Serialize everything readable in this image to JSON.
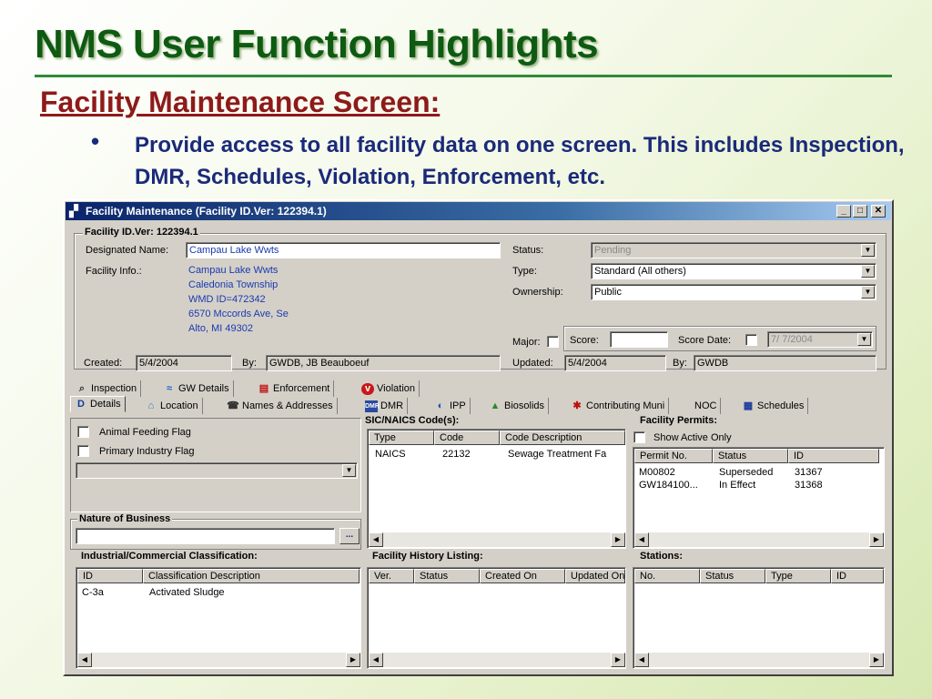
{
  "slide": {
    "title": "NMS User Function Highlights",
    "subtitle": "Facility Maintenance Screen:",
    "bullet_glyph": "•",
    "bullet_text": "Provide access to all facility data on one screen.  This includes Inspection, DMR, Schedules, Violation, Enforcement, etc."
  },
  "window": {
    "title": "Facility Maintenance (Facility ID.Ver: 122394.1)",
    "controls": {
      "minimize": "_",
      "maximize": "□",
      "close": "✕"
    }
  },
  "facility": {
    "group_label": "Facility ID.Ver: 122394.1",
    "designated_name_label": "Designated Name:",
    "designated_name": "Campau Lake Wwts",
    "info_label": "Facility Info.:",
    "info_lines": [
      "Campau Lake Wwts",
      "Caledonia Township",
      "WMD ID=472342",
      "6570 Mccords Ave, Se",
      "Alto, MI 49302"
    ],
    "status_label": "Status:",
    "status": "Pending",
    "type_label": "Type:",
    "type": "Standard (All others)",
    "ownership_label": "Ownership:",
    "ownership": "Public",
    "major_label": "Major:",
    "score_label": "Score:",
    "score": "",
    "score_date_label": "Score Date:",
    "score_date": "7/  7/2004",
    "created_label": "Created:",
    "created": "5/4/2004",
    "created_by_label": "By:",
    "created_by": "GWDB, JB Beauboeuf",
    "updated_label": "Updated:",
    "updated": "5/4/2004",
    "updated_by_label": "By:",
    "updated_by": "GWDB"
  },
  "tabs_row1": [
    {
      "label": "Inspection",
      "icon": "magnifier-icon"
    },
    {
      "label": "GW Details",
      "icon": "water-icon"
    },
    {
      "label": "Enforcement",
      "icon": "enforcement-icon"
    },
    {
      "label": "Violation",
      "icon": "violation-icon"
    }
  ],
  "tabs_row2": [
    {
      "label": "Details",
      "icon": "details-icon"
    },
    {
      "label": "Location",
      "icon": "map-icon"
    },
    {
      "label": "Names & Addresses",
      "icon": "addressbook-icon"
    },
    {
      "label": "DMR",
      "icon": "dmr-icon"
    },
    {
      "label": "IPP",
      "icon": "ipp-icon"
    },
    {
      "label": "Biosolids",
      "icon": "biosolids-icon"
    },
    {
      "label": "Contributing Muni",
      "icon": "muni-icon"
    },
    {
      "label": "NOC",
      "icon": ""
    },
    {
      "label": "Schedules",
      "icon": "calendar-icon"
    }
  ],
  "details": {
    "animal_feeding_label": "Animal Feeding Flag",
    "primary_industry_label": "Primary Industry Flag",
    "nature_label": "Nature of Business",
    "browse_label": "..."
  },
  "sic": {
    "label": "SIC/NAICS Code(s):",
    "headers": [
      "Type",
      "Code",
      "Code Description"
    ],
    "rows": [
      [
        "NAICS",
        "22132",
        "Sewage Treatment Fa"
      ]
    ]
  },
  "permits": {
    "label": "Facility Permits:",
    "show_active_label": "Show Active Only",
    "headers": [
      "Permit No.",
      "Status",
      "ID"
    ],
    "rows": [
      [
        "M00802",
        "Superseded",
        "31367"
      ],
      [
        "GW184100...",
        "In Effect",
        "31368"
      ]
    ]
  },
  "industrial": {
    "label": "Industrial/Commercial Classification:",
    "headers": [
      "ID",
      "Classification Description"
    ],
    "rows": [
      [
        "C-3a",
        "Activated Sludge"
      ]
    ]
  },
  "history": {
    "label": "Facility History Listing:",
    "headers": [
      "Ver.",
      "Status",
      "Created On",
      "Updated On"
    ]
  },
  "stations": {
    "label": "Stations:",
    "headers": [
      "No.",
      "Status",
      "Type",
      "ID"
    ]
  },
  "glyphs": {
    "arrow_down": "▼",
    "arrow_left": "◀",
    "arrow_right": "▶"
  }
}
